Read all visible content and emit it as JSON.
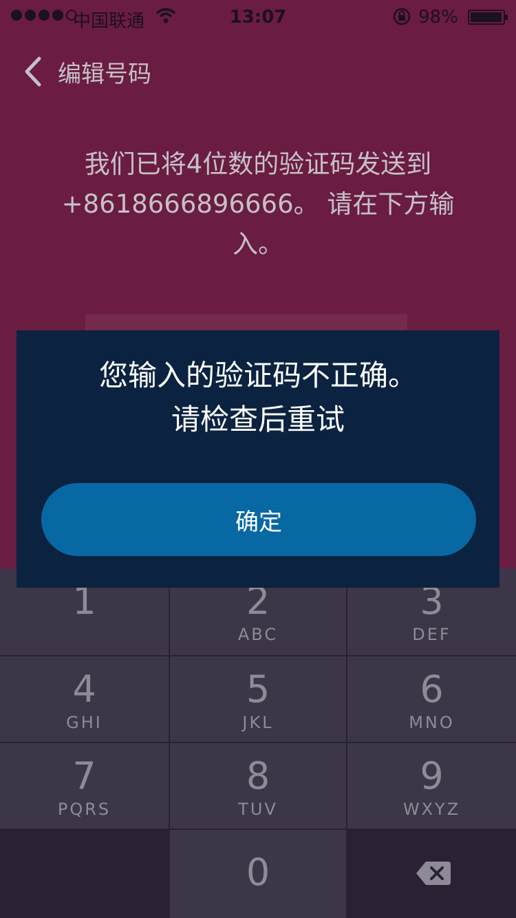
{
  "status_bar": {
    "carrier": "中国联通",
    "time": "13:07",
    "battery": "98%",
    "battery_level": 0.98
  },
  "nav": {
    "back_label": "编辑号码"
  },
  "message": {
    "line1": "我们已将4位数的验证码发送到",
    "line2": "+8618666896666。 请在下方输",
    "line3": "入。"
  },
  "modal": {
    "line1": "您输入的验证码不正确。",
    "line2": "请检查后重试",
    "ok_label": "确定"
  },
  "keypad": {
    "keys": [
      {
        "digit": "1",
        "letters": ""
      },
      {
        "digit": "2",
        "letters": "ABC"
      },
      {
        "digit": "3",
        "letters": "DEF"
      },
      {
        "digit": "4",
        "letters": "GHI"
      },
      {
        "digit": "5",
        "letters": "JKL"
      },
      {
        "digit": "6",
        "letters": "MNO"
      },
      {
        "digit": "7",
        "letters": "PQRS"
      },
      {
        "digit": "8",
        "letters": "TUV"
      },
      {
        "digit": "9",
        "letters": "WXYZ"
      },
      {
        "digit": "0",
        "letters": ""
      }
    ],
    "delete_icon": "backspace-icon"
  },
  "colors": {
    "background": "#6b1c41",
    "modal": "#0b2340",
    "button": "#0868a4",
    "keypad": "#3c3648"
  }
}
